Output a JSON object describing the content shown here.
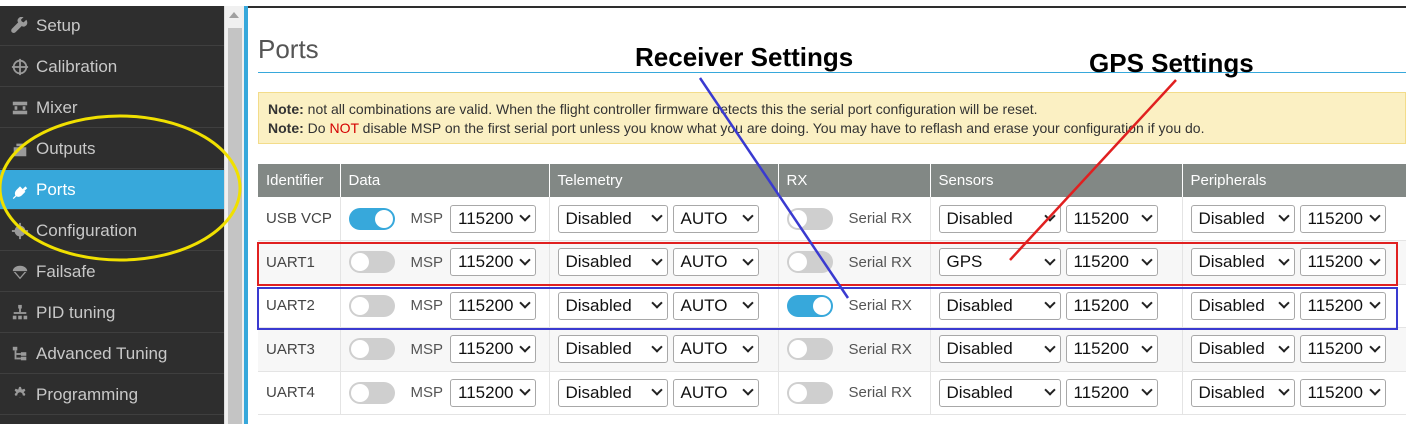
{
  "sidebar": {
    "items": [
      {
        "label": "Setup",
        "icon": "wrench-icon"
      },
      {
        "label": "Calibration",
        "icon": "crosshair-icon"
      },
      {
        "label": "Mixer",
        "icon": "mixer-icon"
      },
      {
        "label": "Outputs",
        "icon": "outputs-icon"
      },
      {
        "label": "Ports",
        "icon": "plug-icon",
        "active": true
      },
      {
        "label": "Configuration",
        "icon": "gear-icon"
      },
      {
        "label": "Failsafe",
        "icon": "parachute-icon"
      },
      {
        "label": "PID tuning",
        "icon": "hierarchy-icon"
      },
      {
        "label": "Advanced Tuning",
        "icon": "tree-icon"
      },
      {
        "label": "Programming",
        "icon": "cog-icon"
      }
    ]
  },
  "page": {
    "title": "Ports",
    "note_label": "Note:",
    "note1": " not all combinations are valid. When the flight controller firmware detects this the serial port configuration will be reset.",
    "note2_a": " Do ",
    "note2_not": "NOT",
    "note2_b": " disable MSP on the first serial port unless you know what you are doing. You may have to reflash and erase your configuration if you do."
  },
  "table": {
    "headers": [
      "Identifier",
      "Data",
      "Telemetry",
      "RX",
      "Sensors",
      "Peripherals"
    ],
    "msp_label": "MSP",
    "serialrx_label": "Serial RX",
    "rows": [
      {
        "id": "USB VCP",
        "msp_on": true,
        "msp_baud": "115200",
        "telemetry": "Disabled",
        "telemetry_baud": "AUTO",
        "rx_on": false,
        "sensor": "Disabled",
        "sensor_baud": "115200",
        "peripheral": "Disabled",
        "peripheral_baud": "115200"
      },
      {
        "id": "UART1",
        "msp_on": false,
        "msp_baud": "115200",
        "telemetry": "Disabled",
        "telemetry_baud": "AUTO",
        "rx_on": false,
        "sensor": "GPS",
        "sensor_baud": "115200",
        "peripheral": "Disabled",
        "peripheral_baud": "115200"
      },
      {
        "id": "UART2",
        "msp_on": false,
        "msp_baud": "115200",
        "telemetry": "Disabled",
        "telemetry_baud": "AUTO",
        "rx_on": true,
        "sensor": "Disabled",
        "sensor_baud": "115200",
        "peripheral": "Disabled",
        "peripheral_baud": "115200"
      },
      {
        "id": "UART3",
        "msp_on": false,
        "msp_baud": "115200",
        "telemetry": "Disabled",
        "telemetry_baud": "AUTO",
        "rx_on": false,
        "sensor": "Disabled",
        "sensor_baud": "115200",
        "peripheral": "Disabled",
        "peripheral_baud": "115200"
      },
      {
        "id": "UART4",
        "msp_on": false,
        "msp_baud": "115200",
        "telemetry": "Disabled",
        "telemetry_baud": "AUTO",
        "rx_on": false,
        "sensor": "Disabled",
        "sensor_baud": "115200",
        "peripheral": "Disabled",
        "peripheral_baud": "115200"
      }
    ]
  },
  "annotations": {
    "receiver": "Receiver Settings",
    "gps": "GPS Settings",
    "colors": {
      "yellow": "#f0e000",
      "red": "#e02020",
      "blue": "#3a3ad0"
    }
  }
}
